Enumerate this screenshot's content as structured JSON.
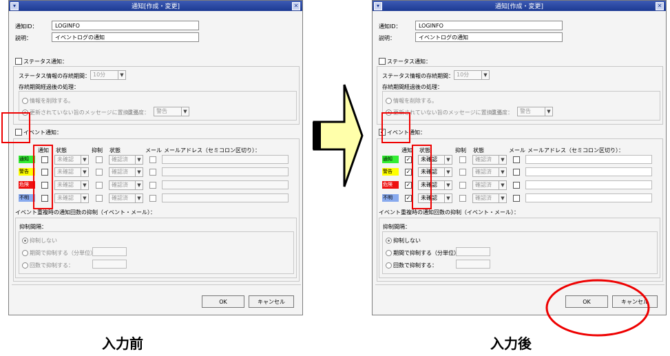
{
  "dialog": {
    "title": "通知[作成・変更]",
    "id_label": "通知ID：",
    "id_value": "LOGINFO",
    "desc_label": "説明：",
    "desc_value": "イベントログの通知",
    "status_notify_label": "ステータス通知：",
    "status_retention_label": "ステータス情報の存続期間：",
    "status_retention_value": "10分",
    "expired_handling_label": "存続期間経過後の処理：",
    "delete_info_label": "情報を削除する。",
    "replace_msg_label": "更新されていない旨のメッセージに置換える",
    "severity_label": "重要度：",
    "severity_value": "警告",
    "event_notify_label": "イベント通知：",
    "columns": {
      "notify": "通知",
      "state1": "状態",
      "suppress": "抑制",
      "state2": "状態",
      "mail": "メール",
      "mail_address": "メールアドレス（セミコロン区切り）："
    },
    "rows": [
      {
        "severity": "通知",
        "color": "#33ee33",
        "state": "未確認",
        "state2": "確認済"
      },
      {
        "severity": "警告",
        "color": "#ffff00",
        "state": "未確認",
        "state2": "確認済"
      },
      {
        "severity": "危険",
        "color": "#ee1111",
        "state": "未確認",
        "state2": "確認済"
      },
      {
        "severity": "不明",
        "color": "#88aaee",
        "state": "未確認",
        "state2": "確認済"
      }
    ],
    "suppress_section_label": "イベント重複時の通知回数の抑制（イベント・メール）：",
    "suppress_interval_label": "抑制間隔：",
    "no_suppress_label": "抑制しない",
    "period_suppress_label": "期間で抑制する（分単位）",
    "count_suppress_label": "回数で抑制する：",
    "ok_label": "OK",
    "cancel_label": "キャンセル"
  },
  "captions": {
    "before": "入力前",
    "after": "入力後"
  },
  "colors": {
    "highlight": "#ee0000",
    "arrow_fill": "#ffffaa",
    "titlebar": "#1c3a93"
  }
}
